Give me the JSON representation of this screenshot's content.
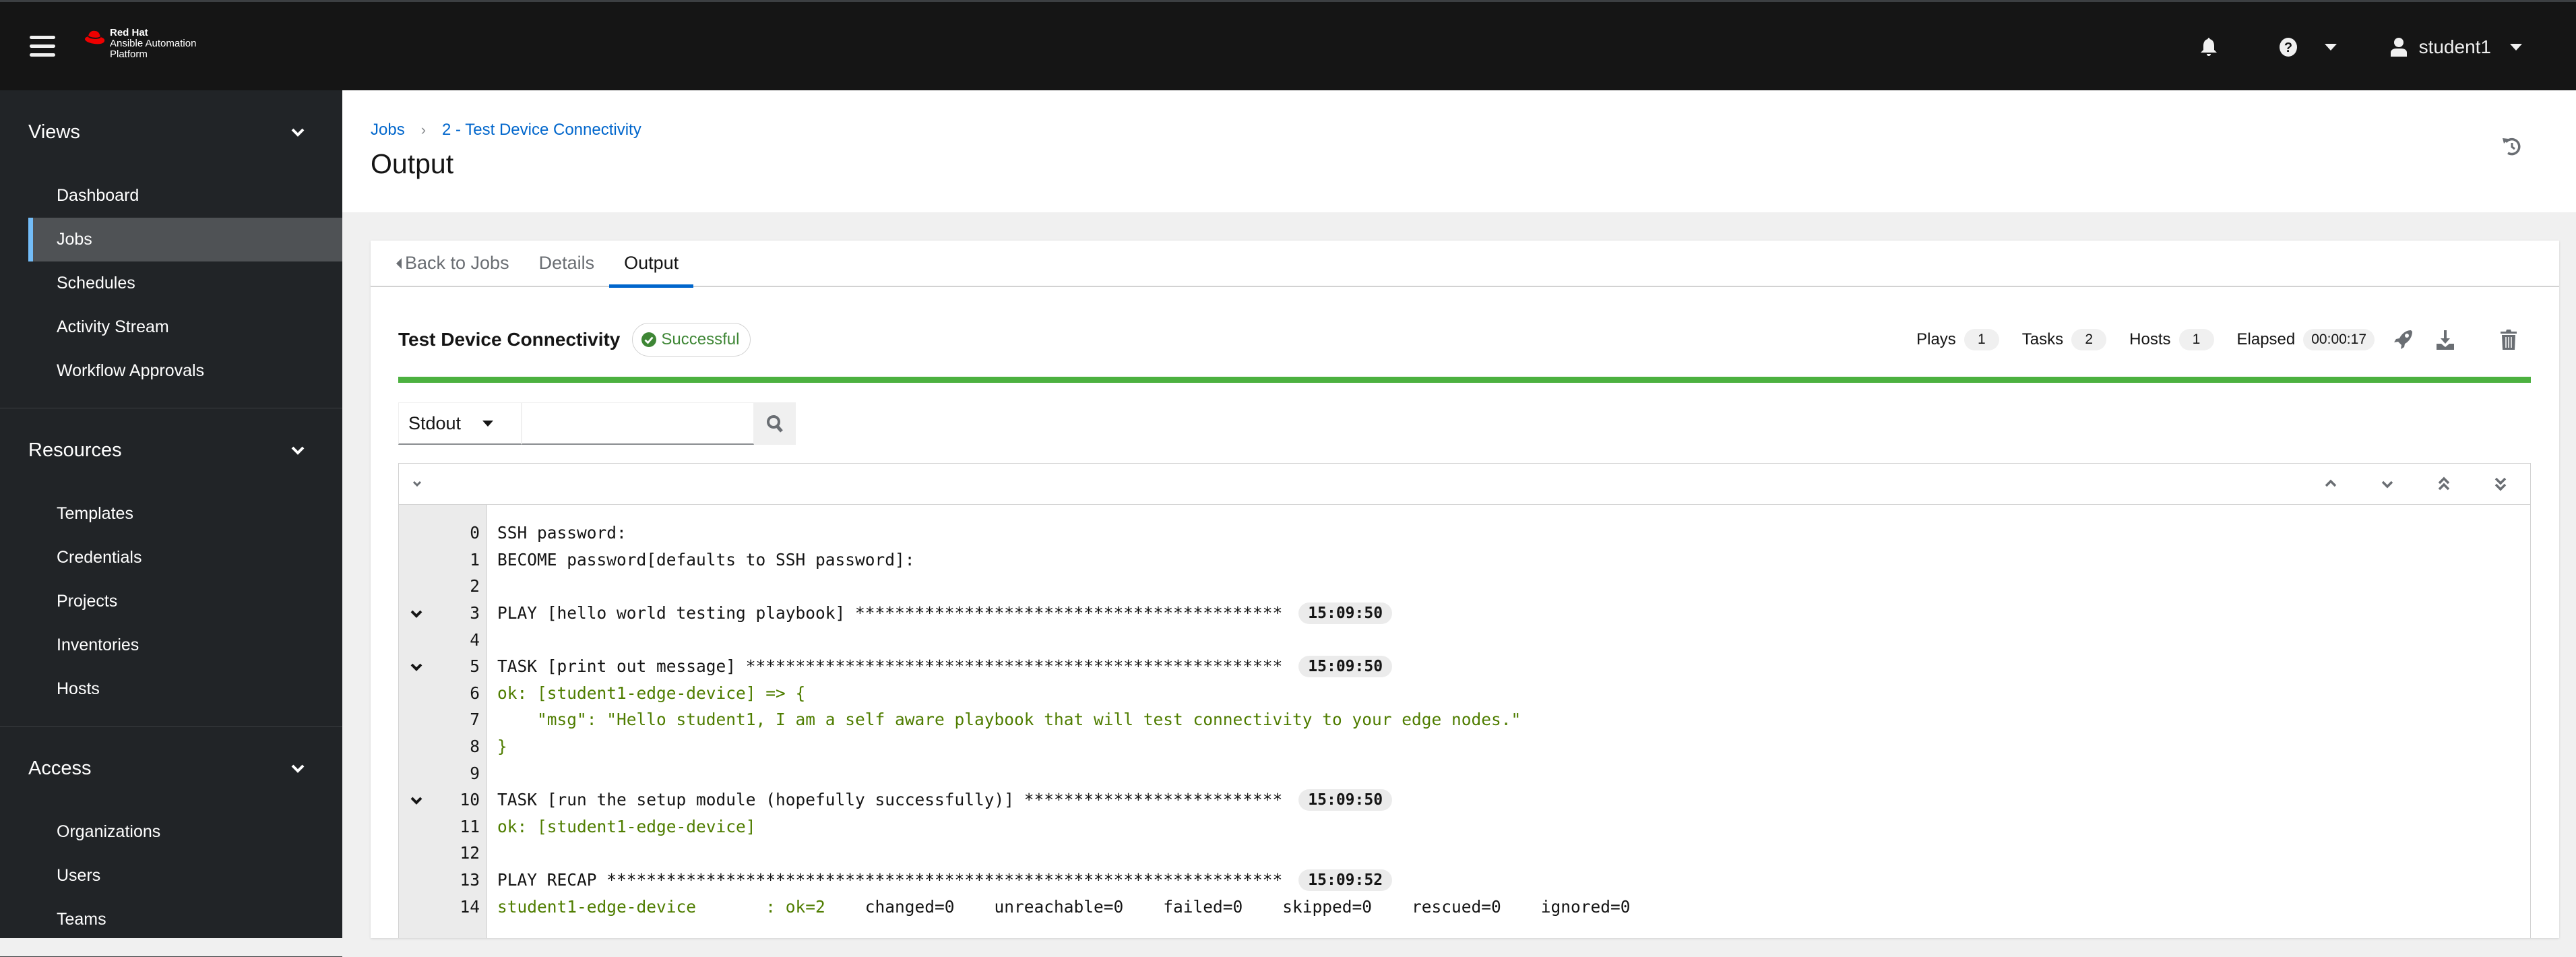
{
  "masthead": {
    "brand_line1": "Red Hat",
    "brand_line2": "Ansible Automation",
    "brand_line3": "Platform",
    "username": "student1",
    "icons": [
      "hamburger-menu-icon",
      "bell-icon",
      "question-circle-icon",
      "user-icon"
    ]
  },
  "sidebar": {
    "groups": [
      {
        "title": "Views",
        "items": [
          "Dashboard",
          "Jobs",
          "Schedules",
          "Activity Stream",
          "Workflow Approvals"
        ],
        "active": "Jobs"
      },
      {
        "title": "Resources",
        "items": [
          "Templates",
          "Credentials",
          "Projects",
          "Inventories",
          "Hosts"
        ]
      },
      {
        "title": "Access",
        "items": [
          "Organizations",
          "Users",
          "Teams"
        ]
      }
    ]
  },
  "page": {
    "breadcrumb": [
      "Jobs",
      "2 - Test Device Connectivity"
    ],
    "title": "Output"
  },
  "tabs": {
    "back": "Back to Jobs",
    "details": "Details",
    "output": "Output",
    "active": "Output"
  },
  "job": {
    "name": "Test Device Connectivity",
    "status": "Successful",
    "plays_label": "Plays",
    "plays": "1",
    "tasks_label": "Tasks",
    "tasks": "2",
    "hosts_label": "Hosts",
    "hosts": "1",
    "elapsed_label": "Elapsed",
    "elapsed": "00:00:17",
    "progress_percent": 100,
    "colors": {
      "success": "#3e8635",
      "progress": "#4cb140",
      "link": "#0066cc",
      "active_nav": "#73bcf7"
    }
  },
  "search": {
    "type_selected": "Stdout",
    "value": "",
    "placeholder": ""
  },
  "log": {
    "lines": [
      {
        "n": "0",
        "text": "SSH password:",
        "style": "plain"
      },
      {
        "n": "1",
        "text": "BECOME password[defaults to SSH password]:",
        "style": "plain"
      },
      {
        "n": "2",
        "text": "",
        "style": "plain"
      },
      {
        "n": "3",
        "text": "PLAY [hello world testing playbook] *******************************************",
        "style": "plain",
        "time": "15:09:50",
        "toggle": true
      },
      {
        "n": "4",
        "text": "",
        "style": "plain"
      },
      {
        "n": "5",
        "text": "TASK [print out message] ******************************************************",
        "style": "plain",
        "time": "15:09:50",
        "toggle": true
      },
      {
        "n": "6",
        "text": "ok: [student1-edge-device] => {",
        "style": "ok"
      },
      {
        "n": "7",
        "text": "    \"msg\": \"Hello student1, I am a self aware playbook that will test connectivity to your edge nodes.\"",
        "style": "ok"
      },
      {
        "n": "8",
        "text": "}",
        "style": "ok"
      },
      {
        "n": "9",
        "text": "",
        "style": "plain"
      },
      {
        "n": "10",
        "text": "TASK [run the setup module (hopefully successfully)] **************************",
        "style": "plain",
        "time": "15:09:50",
        "toggle": true
      },
      {
        "n": "11",
        "text": "ok: [student1-edge-device]",
        "style": "ok"
      },
      {
        "n": "12",
        "text": "",
        "style": "plain"
      },
      {
        "n": "13",
        "text": "PLAY RECAP ********************************************************************",
        "style": "plain",
        "time": "15:09:52"
      },
      {
        "n": "14",
        "recap": true,
        "host": "student1-edge-device       : ",
        "ok": "ok=2",
        "rest": "    changed=0    unreachable=0    failed=0    skipped=0    rescued=0    ignored=0"
      }
    ]
  }
}
